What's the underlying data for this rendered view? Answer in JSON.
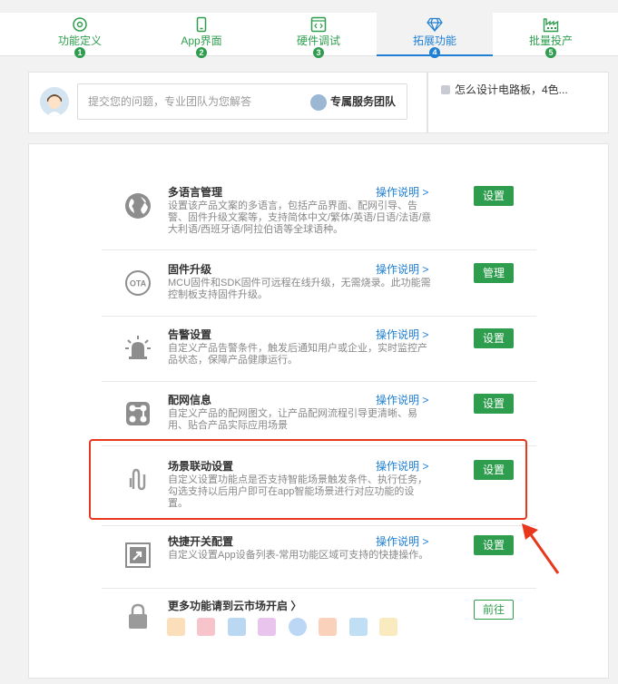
{
  "steps": [
    {
      "label": "功能定义",
      "num": "1",
      "icon": "function-define-icon"
    },
    {
      "label": "App界面",
      "num": "2",
      "icon": "phone-icon"
    },
    {
      "label": "硬件调试",
      "num": "3",
      "icon": "code-icon"
    },
    {
      "label": "拓展功能",
      "num": "4",
      "icon": "diamond-icon"
    },
    {
      "label": "批量投产",
      "num": "5",
      "icon": "factory-icon"
    }
  ],
  "active_step": "拓展功能",
  "question": {
    "placeholder": "提交您的问题，专业团队为您解答",
    "team_label": "专属服务团队"
  },
  "news": {
    "item": "怎么设计电路板，4色..."
  },
  "features": [
    {
      "title": "多语言管理",
      "desc": "设置该产品文案的多语言，包括产品界面、配网引导、告警、固件升级文案等，支持简体中文/繁体/英语/日语/法语/意大利语/西班牙语/阿拉伯语等全球语种。",
      "help": "操作说明 >",
      "button": "设置",
      "icon": "globe-icon"
    },
    {
      "title": "固件升级",
      "desc": "MCU固件和SDK固件可远程在线升级，无需烧录。此功能需控制板支持固件升级。",
      "help": "操作说明 >",
      "button": "管理",
      "icon": "ota-icon"
    },
    {
      "title": "告警设置",
      "desc": "自定义产品告警条件，触发后通知用户或企业，实时监控产品状态，保障产品健康运行。",
      "help": "操作说明 >",
      "button": "设置",
      "icon": "alarm-light-icon"
    },
    {
      "title": "配网信息",
      "desc": "自定义产品的配网图文，让产品配网流程引导更清晰、易用、贴合产品实际应用场景",
      "help": "操作说明 >",
      "button": "设置",
      "icon": "network-config-icon"
    },
    {
      "title": "场景联动设置",
      "desc": "自定义设置功能点是否支持智能场景触发条件、执行任务，勾选支持以后用户即可在app智能场景进行对应功能的设置。",
      "help": "操作说明 >",
      "button": "设置",
      "icon": "scene-link-icon"
    },
    {
      "title": "快捷开关配置",
      "desc": "自定义设置App设备列表-常用功能区域可支持的快捷操作。",
      "help": "操作说明 >",
      "button": "设置",
      "icon": "shortcut-icon"
    }
  ],
  "cloud": {
    "title": "更多功能请到云市场开启 〉",
    "button": "前往",
    "icon": "lock-icon"
  },
  "colors": {
    "green": "#2e9e4e",
    "blue": "#1f7fd4",
    "highlight": "#e8371c"
  }
}
